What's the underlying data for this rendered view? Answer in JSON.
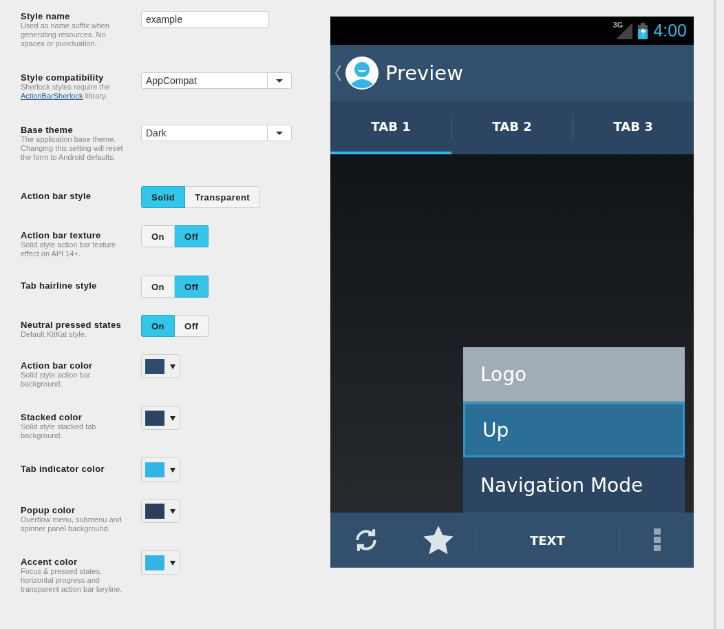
{
  "settings": [
    {
      "kind": "text",
      "label": "Style name",
      "hint": "Used as name suffix when generating resources. No spaces or punctuation.",
      "value": "example"
    },
    {
      "kind": "select",
      "label": "Style compatibility",
      "hint": "Sherlock styles require the",
      "hint_link": "ActionBarSherlock",
      "hint_after": "library.",
      "value": "AppCompat"
    },
    {
      "kind": "select",
      "label": "Base theme",
      "hint": "The application base theme. Changing this setting will reset the form to Android defaults.",
      "value": "Dark"
    },
    {
      "kind": "segmented",
      "label": "Action bar style",
      "options": [
        {
          "label": "Solid",
          "selected": true
        },
        {
          "label": "Transparent",
          "selected": false
        }
      ]
    },
    {
      "kind": "segmented",
      "label": "Action bar texture",
      "hint": "Solid style action bar texture effect on API 14+.",
      "options": [
        {
          "label": "On",
          "selected": false
        },
        {
          "label": "Off",
          "selected": true
        }
      ]
    },
    {
      "kind": "segmented",
      "label": "Tab hairline style",
      "options": [
        {
          "label": "On",
          "selected": false
        },
        {
          "label": "Off",
          "selected": true
        }
      ]
    },
    {
      "kind": "segmented",
      "label": "Neutral pressed states",
      "hint": "Default KitKat style.",
      "options": [
        {
          "label": "On",
          "selected": true
        },
        {
          "label": "Off",
          "selected": false
        }
      ]
    },
    {
      "kind": "color",
      "label": "Action bar color",
      "hint": "Solid style action bar background.",
      "color": "#2e4d6e"
    },
    {
      "kind": "color",
      "label": "Stacked color",
      "hint": "Solid style stacked tab background.",
      "color": "#2c4562"
    },
    {
      "kind": "color",
      "label": "Tab indicator color",
      "color": "#33b5e5"
    },
    {
      "kind": "color",
      "label": "Popup color",
      "hint": "Overflow menu, submenu and spinner panel background.",
      "color": "#2a405c"
    },
    {
      "kind": "color",
      "label": "Accent color",
      "hint": "Focus & pressed states, horizontal progress and transparent action bar keyline.",
      "color": "#33b5e5"
    }
  ],
  "preview": {
    "status_bar": {
      "network": "3G",
      "time": "4:00"
    },
    "action_bar": {
      "title": "Preview"
    },
    "tabs": [
      {
        "label": "TAB 1",
        "selected": true
      },
      {
        "label": "TAB 2",
        "selected": false
      },
      {
        "label": "TAB 3",
        "selected": false
      }
    ],
    "menu": [
      {
        "label": "Logo",
        "pressed": true,
        "focused": false
      },
      {
        "label": "Up",
        "pressed": false,
        "focused": true
      },
      {
        "label": "Navigation Mode",
        "pressed": false,
        "focused": false
      }
    ],
    "bottom_bar": {
      "text": "TEXT"
    }
  }
}
